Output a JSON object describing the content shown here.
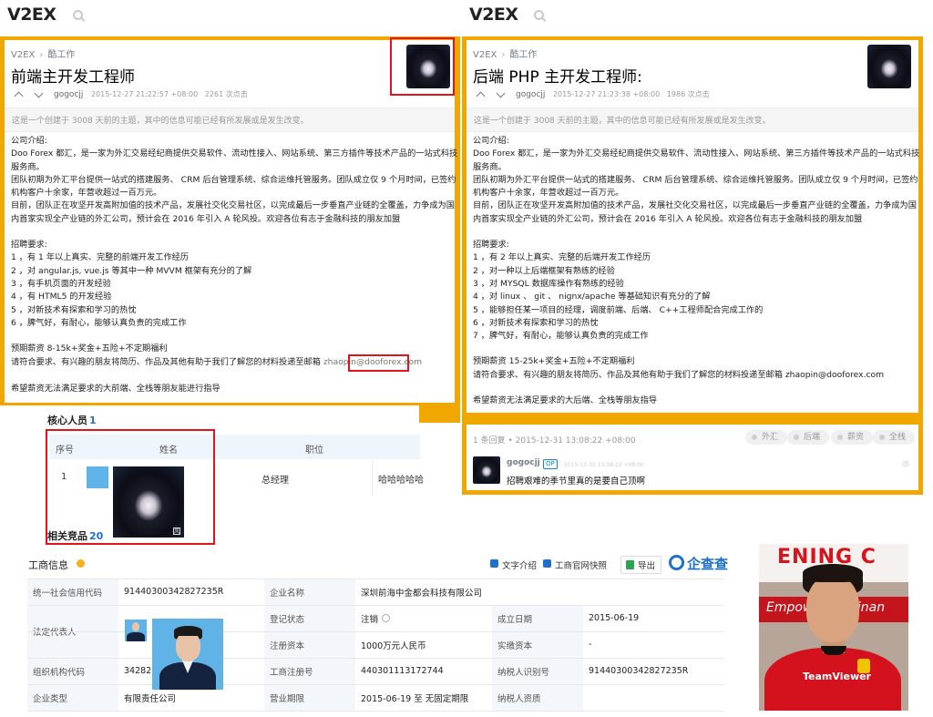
{
  "left_topic": {
    "logo": "V2EX",
    "breadcrumb": [
      "V2EX",
      "酷工作"
    ],
    "title": "前端主开发工程师",
    "author": "gogocjj",
    "timestamp": "2015-12-27 21:22:57 +08:00",
    "clicks": "2261 次点击",
    "notice": "这是一个创建于 3008 天前的主题，其中的信息可能已经有所发展或是发生改变。",
    "content": [
      "公司介绍:",
      "Doo Forex 都汇，是一家为外汇交易经纪商提供交易软件、流动性接入、网站系统、第三方插件等技术产品的一站式科技",
      "服务商。",
      "团队初期为外汇平台提供一站式的搭建服务、 CRM 后台管理系统、综合运维托管服务。团队成立仅 9 个月时间，已签约",
      "机构客户十余家，年营收超过一百万元。",
      "目前，团队正在攻坚开发高附加值的技术产品，发展社交化交易社区，以完成最后一步垂直产业链的全覆盖，力争成为国",
      "内首家实现全产业链的外汇公司，预计会在 2016 年引入 A 轮风投。欢迎各位有志于金融科技的朋友加盟",
      "",
      "招聘要求:",
      "1 ，有 1 年以上真实、完整的前端开发工作经历",
      "2 ，对 angular.js, vue.js 等其中一种 MVVM 框架有充分的了解",
      "3 ，有手机页面的开发经验",
      "4 ，有 HTML5 的开发经验",
      "5 ，对新技术有探索和学习的热忱",
      "6 ，脾气好，有耐心，能够认真负责的完成工作",
      "",
      "预期薪资 8-15k+奖金+五险+不定期福利"
    ],
    "apply_text": "请符合要求、有兴趣的朋友将简历、作品及其他有助于我们了解您的材料投递至邮箱",
    "email_user": "zhaopin",
    "email_domain": "@dooforex.com",
    "closing": "希望薪资无法满足要求的大前端、全栈等朋友能进行指导"
  },
  "right_topic": {
    "logo": "V2EX",
    "breadcrumb": [
      "V2EX",
      "酷工作"
    ],
    "title": "后端 PHP 主开发工程师:",
    "author": "gogocjj",
    "timestamp": "2015-12-27 21:23:38 +08:00",
    "clicks": "1986 次点击",
    "notice": "这是一个创建于 3008 天前的主题，其中的信息可能已经有所发展或是发生改变。",
    "content": [
      "公司介绍:",
      "Doo Forex 都汇，是一家为外汇交易经纪商提供交易软件、流动性接入、网站系统、第三方插件等技术产品的一站式科技",
      "服务商。",
      "团队初期为外汇平台提供一站式的搭建服务、 CRM 后台管理系统、综合运维托管服务。团队成立仅 9 个月时间，已签约",
      "机构客户十余家，年营收超过一百万元。",
      "目前，团队正在攻坚开发高附加值的技术产品，发展社交化交易社区，以完成最后一步垂直产业链的全覆盖，力争成为国",
      "内首家实现全产业链的外汇公司，预计会在 2016 年引入 A 轮风投。欢迎各位有志于金融科技的朋友加盟",
      "",
      "招聘要求:",
      "1 ，有 2 年以上真实、完整的后端开发工作经历",
      "2 ，对一种以上后端框架有熟练的经验",
      "3 ，对 MYSQL 数据库操作有熟练的经验",
      "4 ，对 linux 、 git 、 nignx/apache 等基础知识有充分的了解",
      "5 ，能够担任某一项目的经理，调度前端、后端、 C++工程师配合完成工作的",
      "6 ，对新技术有探索和学习的热忱",
      "7 ，脾气好，有耐心，能够认真负责的完成工作",
      "",
      "预期薪资 15-25k+奖金+五险+不定期福利",
      "请符合要求、有兴趣的朋友将简历、作品及其他有助于我们了解您的材料投递至邮箱 zhaopin@dooforex.com",
      "",
      "希望薪资无法满足要求的大后端、全栈等朋友指导"
    ],
    "replies_head": "1 条回复  •  2015-12-31 13:08:22 +08:00",
    "tags": [
      "外汇",
      "后端",
      "薪资",
      "全栈"
    ],
    "reply": {
      "author": "gogocjj",
      "badge": "OP",
      "time": "2015-12-31 13:08:22 +08:00",
      "text": "招聘艰难的季节里真的是要自己顶啊"
    }
  },
  "core_members": {
    "title": "核心人员",
    "count": "1",
    "headers": [
      "序号",
      "姓名",
      "职位"
    ],
    "row": {
      "index": "1",
      "position": "总经理",
      "extra": "哈哈哈哈哈"
    },
    "related_title": "相关竞品",
    "related_count": "20"
  },
  "business_info": {
    "title": "工商信息",
    "tools": [
      "文字介绍",
      "工商官网快照",
      "导出"
    ],
    "brand": "企查查",
    "rows_left": [
      {
        "label": "统一社会信用代码",
        "value": "91440300342827235R"
      },
      {
        "label": "法定代表人",
        "value": ""
      },
      {
        "label": "组织机构代码",
        "value": "342827"
      },
      {
        "label": "企业类型",
        "value": "有限责任公司"
      }
    ],
    "rows_mid": [
      {
        "label": "企业名称",
        "value": "深圳前海中金都会科技有限公司"
      },
      {
        "label": "登记状态",
        "value": "注销"
      },
      {
        "label": "注册资本",
        "value": "1000万元人民币"
      },
      {
        "label": "工商注册号",
        "value": "440301113172744"
      },
      {
        "label": "营业期限",
        "value": "2015-06-19 至 无固定期限"
      }
    ],
    "rows_right": [
      {
        "label": "成立日期",
        "value": "2015-06-19"
      },
      {
        "label": "实缴资本",
        "value": "-"
      },
      {
        "label": "纳税人识别号",
        "value": "91440300342827235R"
      },
      {
        "label": "纳税人资质",
        "value": ""
      }
    ]
  },
  "photo": {
    "banner_text": "ENING C",
    "band_text": "Empowering Finan",
    "sponsor": "TeamViewer"
  },
  "colors": {
    "frame": "#f0a800",
    "highlight": "#e0141c",
    "link_blue": "#1e70c9"
  }
}
